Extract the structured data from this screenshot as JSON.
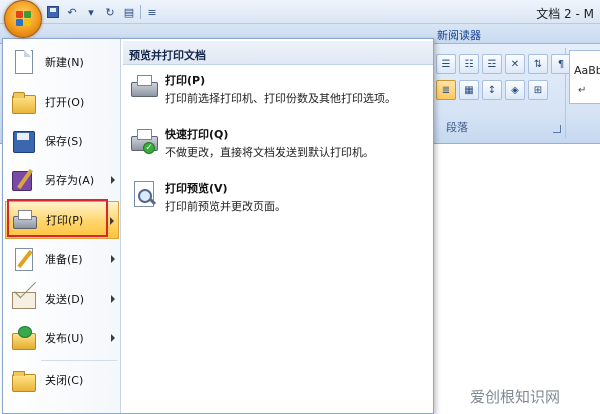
{
  "window": {
    "title": "文档 2 - M"
  },
  "ribbon": {
    "tab_reader": "新阅读器",
    "paragraph_group_label": "段落",
    "style_sample": "AaBb",
    "style_mark": "↵"
  },
  "office_menu": {
    "items": [
      {
        "label": "新建(N)",
        "icon": "new-document-icon",
        "has_arrow": false
      },
      {
        "label": "打开(O)",
        "icon": "open-folder-icon",
        "has_arrow": false
      },
      {
        "label": "保存(S)",
        "icon": "save-disk-icon",
        "has_arrow": false
      },
      {
        "label": "另存为(A)",
        "icon": "save-as-icon",
        "has_arrow": true
      },
      {
        "label": "打印(P)",
        "icon": "printer-icon",
        "has_arrow": true,
        "selected": true
      },
      {
        "label": "准备(E)",
        "icon": "prepare-document-icon",
        "has_arrow": true
      },
      {
        "label": "发送(D)",
        "icon": "send-envelope-icon",
        "has_arrow": true
      },
      {
        "label": "发布(U)",
        "icon": "publish-icon",
        "has_arrow": true
      },
      {
        "label": "关闭(C)",
        "icon": "close-folder-icon",
        "has_arrow": false
      }
    ]
  },
  "print_submenu": {
    "header": "预览并打印文档",
    "options": [
      {
        "title": "打印(P)",
        "description": "打印前选择打印机、打印份数及其他打印选项。",
        "icon": "printer-icon"
      },
      {
        "title": "快速打印(Q)",
        "description": "不做更改，直接将文档发送到默认打印机。",
        "icon": "quick-print-icon"
      },
      {
        "title": "打印预览(V)",
        "description": "打印前预览并更改页面。",
        "icon": "print-preview-icon"
      }
    ]
  },
  "watermark": {
    "text": "爱创根知识网"
  },
  "colors": {
    "selection_highlight": "#ffd56a",
    "annotation_border": "#d7262e",
    "menu_border": "#8ba7cf"
  }
}
